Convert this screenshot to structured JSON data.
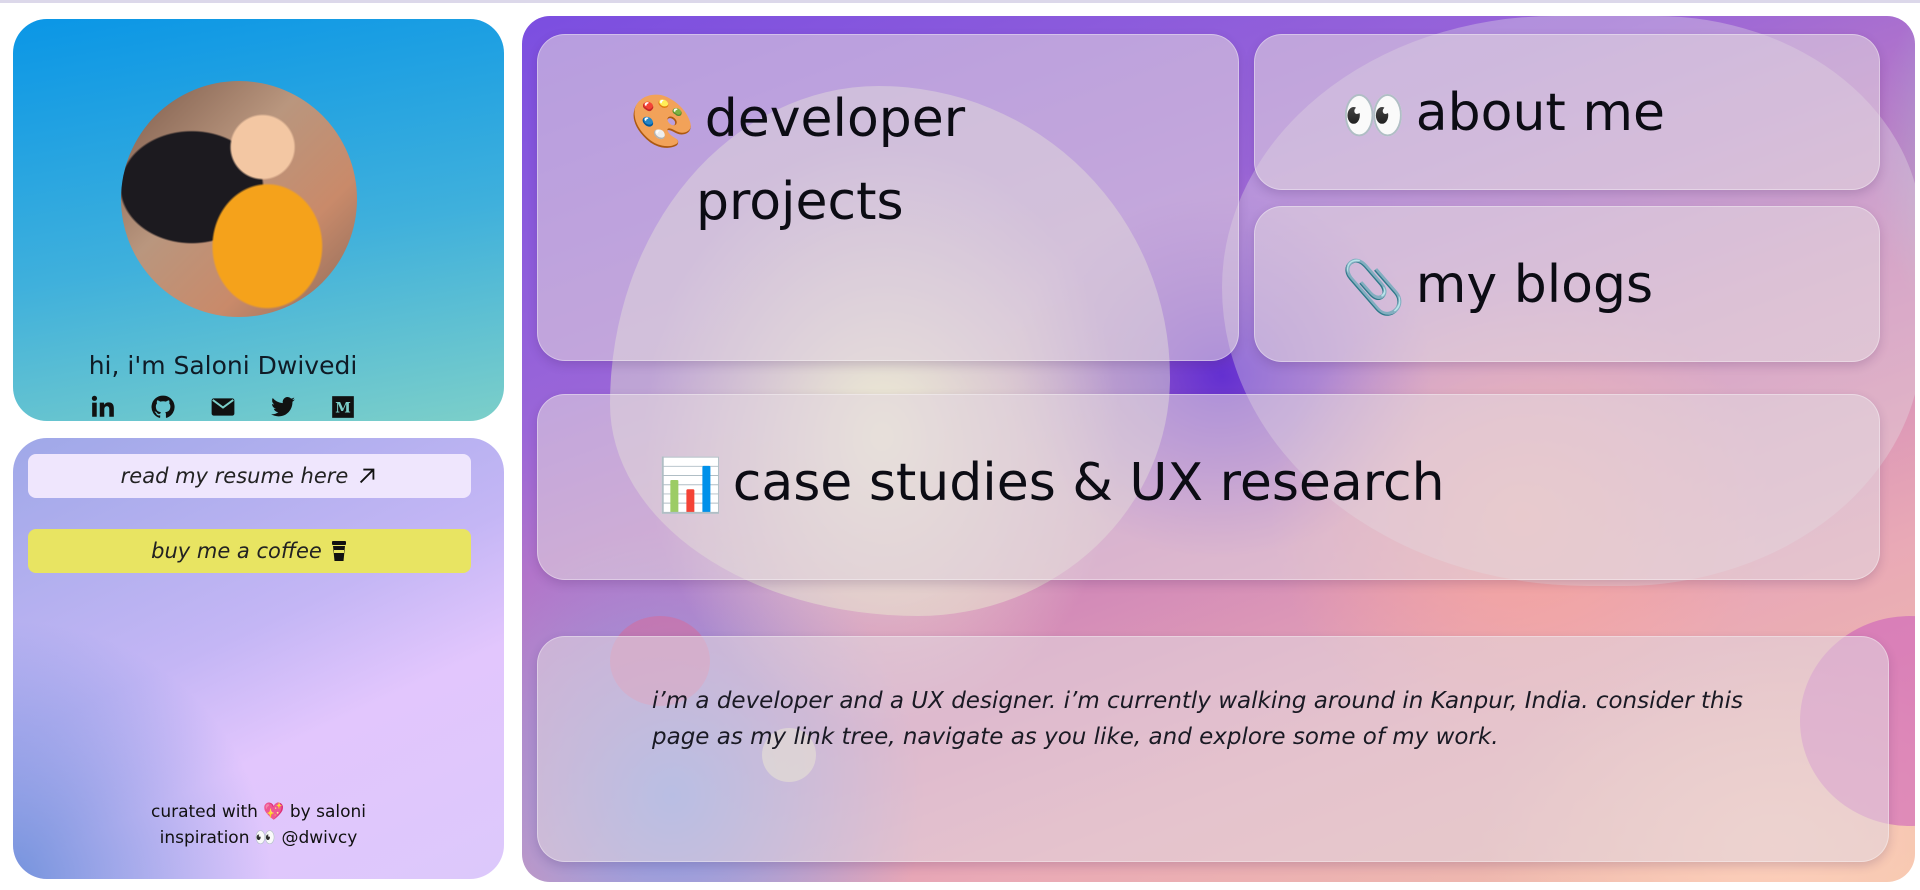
{
  "profile": {
    "name": "hi, i'm Saloni Dwivedi",
    "socials": [
      {
        "name": "linkedin",
        "icon": "linkedin-icon"
      },
      {
        "name": "github",
        "icon": "github-icon"
      },
      {
        "name": "email",
        "icon": "envelope-icon"
      },
      {
        "name": "twitter",
        "icon": "twitter-icon"
      },
      {
        "name": "medium",
        "icon": "medium-icon"
      }
    ]
  },
  "links": {
    "resume_label": "read my resume here",
    "coffee_label": "buy me a coffee",
    "credits_line1": "curated with 💖 by saloni",
    "credits_line2": "inspiration 👀 @dwivcy"
  },
  "tiles": {
    "projects": {
      "emoji": "🎨",
      "title_line1": "developer",
      "title_line2": "projects"
    },
    "about": {
      "emoji": "👀",
      "title": "about me"
    },
    "blogs": {
      "emoji": "📎",
      "title": "my blogs"
    },
    "case": {
      "emoji": "📊",
      "title": "case studies & UX research"
    },
    "bio": {
      "text": "i’m a developer and a UX designer. i’m currently walking around in Kanpur, India. consider this page as my link tree, navigate as you like, and explore some of my work."
    }
  },
  "colors": {
    "profile_gradient_top": "#0a96e6",
    "profile_gradient_bottom": "#7ccfc9",
    "coffee_button": "#e8e462",
    "resume_button": "#efe6fd"
  }
}
